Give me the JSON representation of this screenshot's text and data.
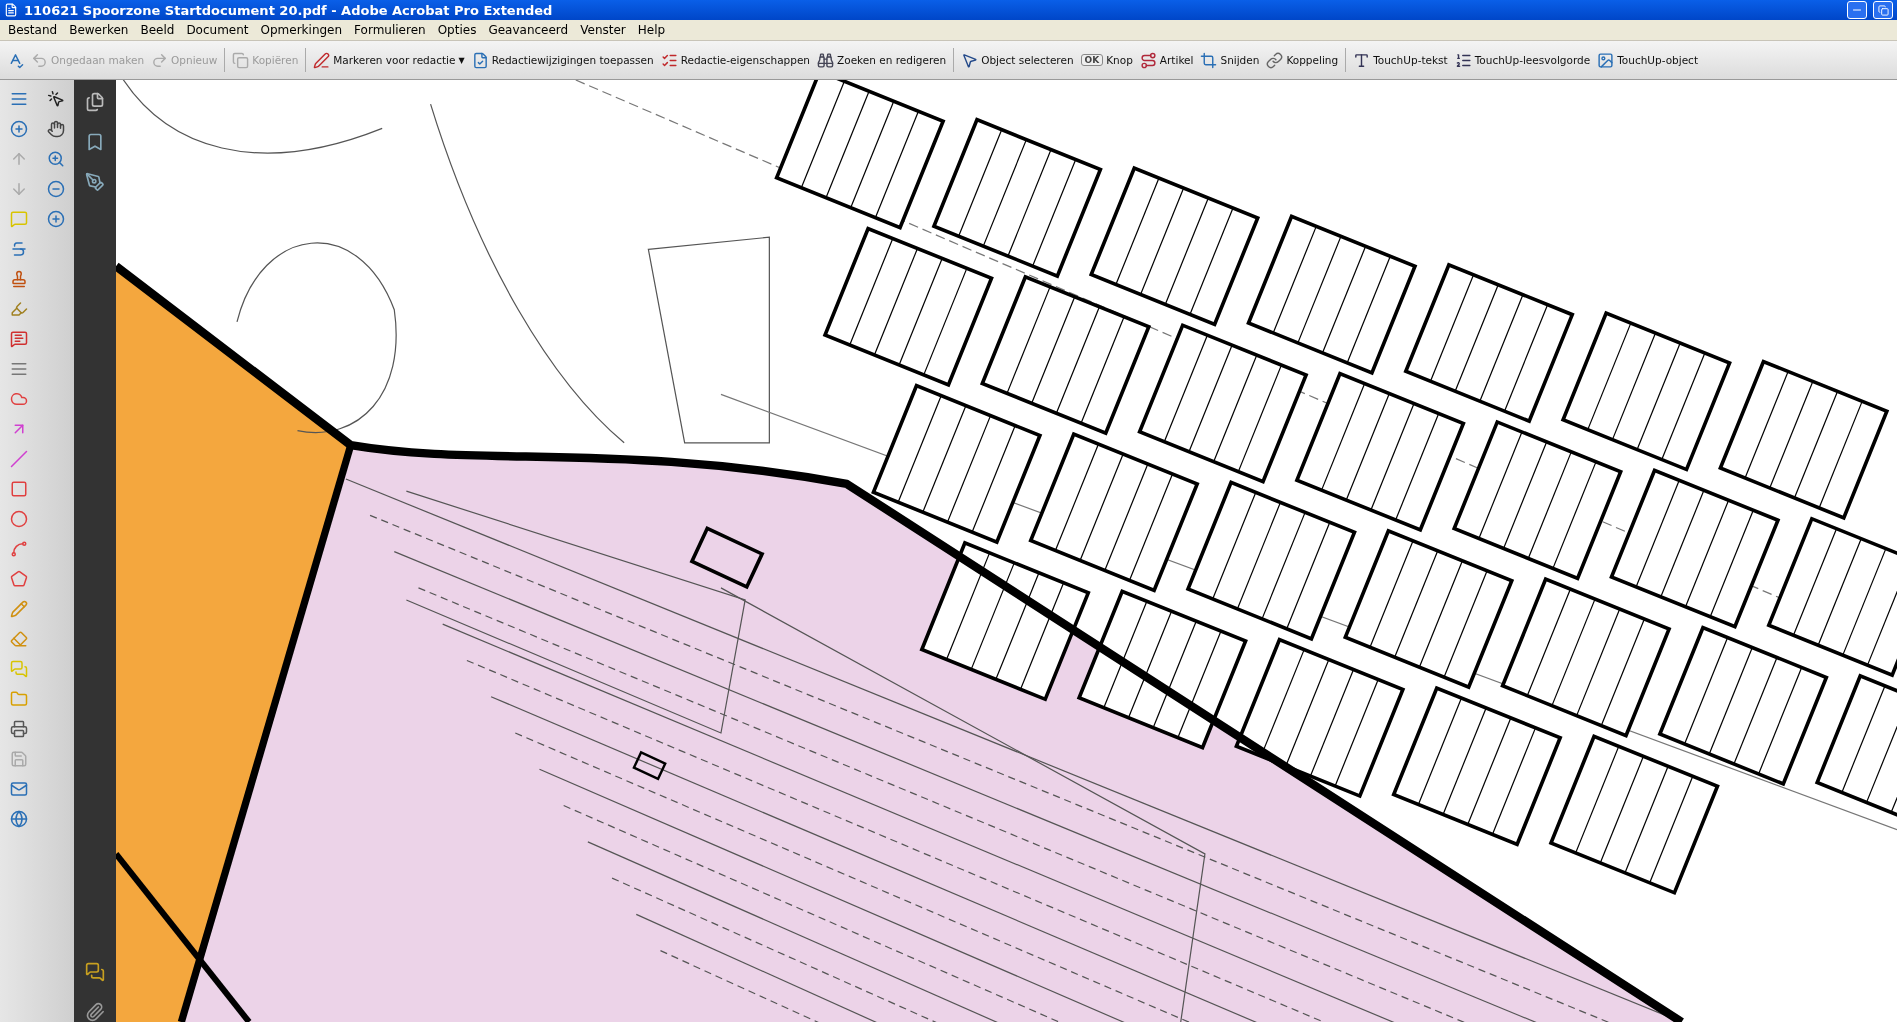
{
  "window": {
    "title": "110621 Spoorzone Startdocument 20.pdf - Adobe Acrobat Pro Extended"
  },
  "menu": [
    "Bestand",
    "Bewerken",
    "Beeld",
    "Document",
    "Opmerkingen",
    "Formulieren",
    "Opties",
    "Geavanceerd",
    "Venster",
    "Help"
  ],
  "toolbar": [
    {
      "disabled": false,
      "separator_after": false
    },
    {
      "label": "Ongedaan maken",
      "disabled": true,
      "separator_after": false
    },
    {
      "label": "Opnieuw",
      "disabled": true,
      "separator_after": true
    },
    {
      "label": "Kopiëren",
      "disabled": true,
      "separator_after": true
    },
    {
      "label": "Markeren voor redactie",
      "disabled": false,
      "caret": "▼",
      "separator_after": false
    },
    {
      "label": "Redactiewijzigingen toepassen",
      "disabled": false,
      "separator_after": false
    },
    {
      "label": "Redactie-eigenschappen",
      "disabled": false,
      "separator_after": false
    },
    {
      "label": "Zoeken en redigeren",
      "disabled": false,
      "separator_after": true
    },
    {
      "label": "Object selecteren",
      "disabled": false,
      "separator_after": false
    },
    {
      "label": "Knop",
      "disabled": false,
      "separator_after": false
    },
    {
      "label": "Artikel",
      "disabled": false,
      "separator_after": false
    },
    {
      "label": "Snijden",
      "disabled": false,
      "separator_after": false
    },
    {
      "label": "Koppeling",
      "disabled": false,
      "separator_after": true
    },
    {
      "label": "TouchUp-tekst",
      "disabled": false,
      "separator_after": false
    },
    {
      "label": "TouchUp-leesvolgorde",
      "disabled": false,
      "separator_after": false
    },
    {
      "label": "TouchUp-object",
      "disabled": false,
      "separator_after": false
    }
  ],
  "ok_icon_text": "OK"
}
